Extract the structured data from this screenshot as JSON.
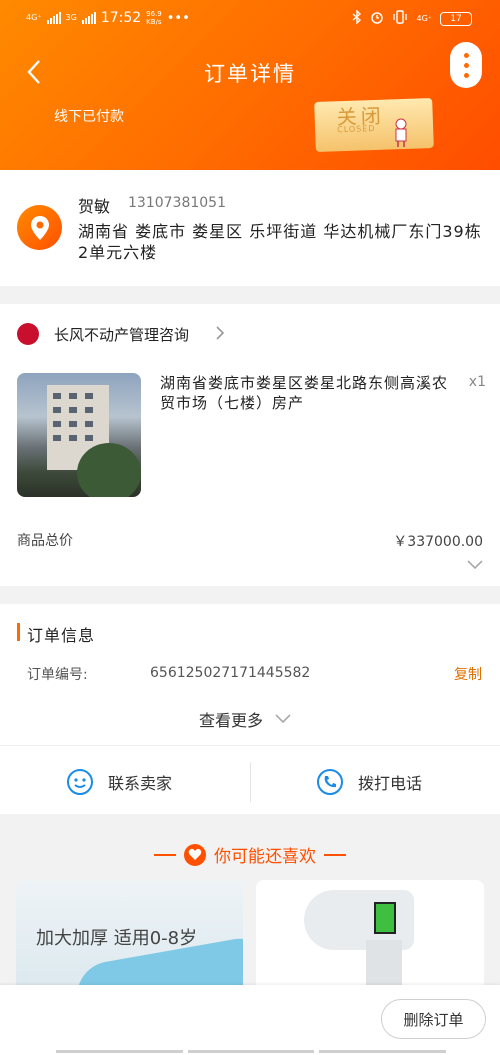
{
  "status_bar": {
    "net1": "4G⁺",
    "net2": "3G",
    "time": "17:52",
    "speed_top": "96.9",
    "speed_unit": "KB/s",
    "dots": "•••",
    "net3": "4G⁺",
    "battery": "17"
  },
  "header": {
    "title": "订单详情",
    "payment_type": "线下已付款",
    "status_cn": "关闭",
    "status_en": "CLOSED"
  },
  "address": {
    "name": "贺敏",
    "phone": "13107381051",
    "full": "湖南省 娄底市 娄星区 乐坪街道 华达机械厂东门39栋2单元六楼"
  },
  "order": {
    "shop_name": "长风不动产管理咨询",
    "product_desc": "湖南省娄底市娄星区娄星北路东侧高溪农贸市场（七楼）房产",
    "quantity": "x1",
    "total_label": "商品总价",
    "total_value": "￥337000.00"
  },
  "info": {
    "title": "订单信息",
    "order_no_label": "订单编号:",
    "order_no": "656125027171445582",
    "copy_label": "复制",
    "see_more": "查看更多",
    "contact_seller": "联系卖家",
    "call_phone": "拨打电话"
  },
  "recommend": {
    "title": "你可能还喜欢",
    "card1_text": "加大加厚 适用0-8岁"
  },
  "bottom": {
    "delete_order": "删除订单"
  },
  "colors": {
    "accent": "#ff6a00",
    "link": "#e07000"
  }
}
